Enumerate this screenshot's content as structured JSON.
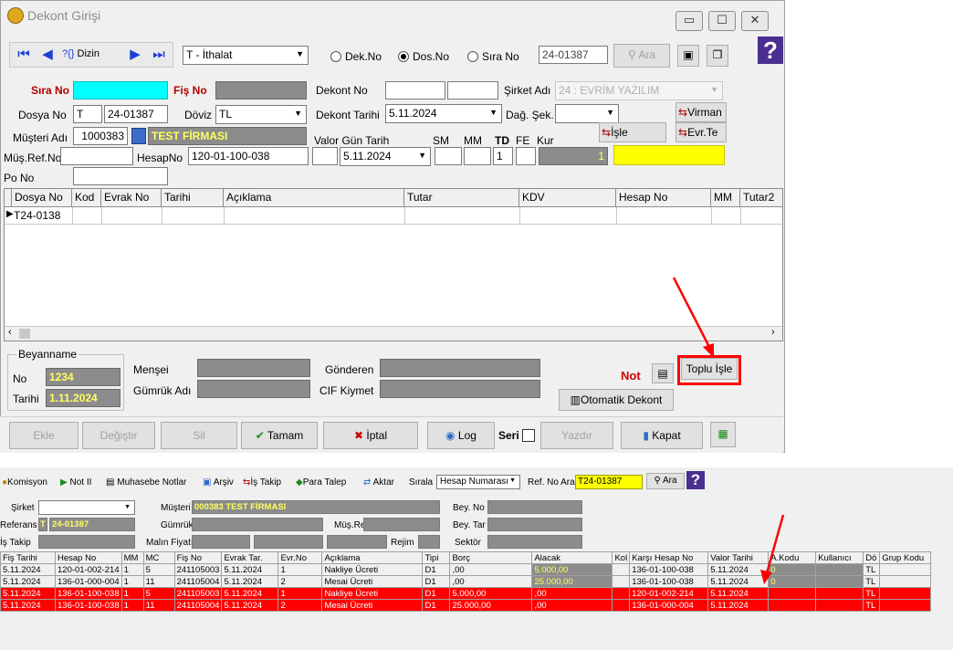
{
  "window": {
    "title": "Dekont Girişi"
  },
  "window_controls": {
    "minimize": "▭",
    "maximize": "☐",
    "close": "✕"
  },
  "nav": {
    "first": "⏮",
    "prev": "◀",
    "dizin": "Dizin",
    "dizin_prefix": "?{}",
    "next": "▶",
    "last": "⏭"
  },
  "type_select": {
    "value": "T - İthalat"
  },
  "search_modes": [
    {
      "label": "Dek.No",
      "selected": false
    },
    {
      "label": "Dos.No",
      "selected": true
    },
    {
      "label": "Sıra No",
      "selected": false
    }
  ],
  "search": {
    "value": "24-01387",
    "button": "Ara"
  },
  "help_icon": "?",
  "form": {
    "sira_no_label": "Sıra No",
    "sira_no": "",
    "fis_no_label": "Fiş No",
    "fis_no": "",
    "dekont_no_label": "Dekont No",
    "dekont_no": "",
    "dekont_no2": "",
    "sirket_label": "Şirket Adı",
    "sirket": "24 : EVRİM YAZILIM",
    "dosya_no_label": "Dosya No",
    "dosya_prefix": "T",
    "dosya_no": "24-01387",
    "doviz_label": "Döviz",
    "doviz": "TL",
    "dekont_tarihi_label": "Dekont Tarihi",
    "dekont_tarihi": "5.11.2024",
    "dag_sek_label": "Dağ. Şek.",
    "dag_sek": "",
    "virman_btn": "Virman",
    "musteri_label": "Müşteri Adı",
    "musteri_kod": "1000383",
    "musteri_ad": "TEST FİRMASI",
    "valor_label": "Valor Gün Tarih",
    "sm_label": "SM",
    "mm_label": "MM",
    "td_label": "TD",
    "fe_label": "FE",
    "kur_label": "Kur",
    "isle_btn": "İşle",
    "evr_btn": "Evr.Te",
    "mus_ref_label": "Müş.Ref.No",
    "mus_ref": "",
    "hesap_no_label": "HesapNo",
    "hesap_no": "120-01-100-038",
    "valor_tarih": "5.11.2024",
    "td_value": "1",
    "kur_value": "1",
    "po_no_label": "Po No",
    "po_no": ""
  },
  "grid": {
    "columns": [
      "Dosya No",
      "Kod",
      "Evrak No",
      "Tarihi",
      "Açıklama",
      "Tutar",
      "KDV",
      "Hesap No",
      "MM",
      "Tutar2"
    ],
    "rows": [
      {
        "dosya_no": "T24-0138"
      }
    ]
  },
  "beyanname": {
    "group_label": "Beyanname",
    "no_label": "No",
    "no": "1234",
    "tarihi_label": "Tarihi",
    "tarihi": "1.11.2024",
    "mensei_label": "Menşei",
    "gumruk_label": "Gümrük Adı",
    "gonderen_label": "Gönderen",
    "cif_label": "CIF Kiymet",
    "not_label": "Not",
    "toplu_isle_btn": "Toplu İşle",
    "otomatik_btn": "Otomatik Dekont"
  },
  "actions": {
    "ekle": "Ekle",
    "degistir": "Değiştir",
    "sil": "Sil",
    "tamam": "Tamam",
    "iptal": "İptal",
    "log": "Log",
    "seri": "Seri",
    "yazdir": "Yazdır",
    "kapat": "Kapat"
  },
  "bottom_toolbar": {
    "komisyon": "Komisyon",
    "not_ii": "Not II",
    "muhasebe": "Muhasebe Notlar",
    "arsiv": "Arşiv",
    "is_takip": "İş Takip",
    "para_talep": "Para Talep",
    "aktar": "Aktar",
    "sirala_label": "Sırala",
    "sirala_value": "Hesap Numarası",
    "ref_label": "Ref. No Ara",
    "ref_value": "T24-01387",
    "ara": "Ara"
  },
  "bottom_form": {
    "sirket_label": "Şirket",
    "musteri_label": "Müşteri",
    "musteri_value": "000383 TEST FİRMASI",
    "bey_no_label": "Bey. No",
    "referans_label": "Referans",
    "referans_prefix": "T",
    "referans_value": "24-01387",
    "gumruk_label": "Gümrük",
    "mus_ref_label": "Müş.Ref",
    "bey_tar_label": "Bey. Tar",
    "is_takip_label": "İş Takip",
    "malin_fiyati_label": "Malın Fiyatı",
    "rejim_label": "Rejim",
    "sektor_label": "Sektör"
  },
  "ledger": {
    "columns": [
      "Fiş Tarihi",
      "Hesap No",
      "MM",
      "MC",
      "Fiş No",
      "Evrak Tar.",
      "Evr.No",
      "Açıklama",
      "Tipi",
      "Borç",
      "Alacak",
      "Kol",
      "Karşı Hesap No",
      "Valor Tarihi",
      "A.Kodu",
      "Kullanıcı",
      "Dö",
      "Grup Kodu"
    ],
    "rows": [
      {
        "fis_tarihi": "5.11.2024",
        "hesap_no": "120-01-002-214",
        "mm": "1",
        "mc": "5",
        "fis_no": "241105003",
        "evrak_tar": "5.11.2024",
        "evr_no": "1",
        "aciklama": "Nakliye Ücreti",
        "tipi": "D1",
        "borc": ",00",
        "alacak": "5.000,00",
        "kol": "",
        "karsi": "136-01-100-038",
        "valor": "5.11.2024",
        "akodu": "0",
        "kullanici": "",
        "do": "TL",
        "grup": "",
        "red": false
      },
      {
        "fis_tarihi": "5.11.2024",
        "hesap_no": "136-01-000-004",
        "mm": "1",
        "mc": "11",
        "fis_no": "241105004",
        "evrak_tar": "5.11.2024",
        "evr_no": "2",
        "aciklama": "Mesai Ücreti",
        "tipi": "D1",
        "borc": ",00",
        "alacak": "25.000,00",
        "kol": "",
        "karsi": "136-01-100-038",
        "valor": "5.11.2024",
        "akodu": "0",
        "kullanici": "",
        "do": "TL",
        "grup": "",
        "red": false
      },
      {
        "fis_tarihi": "5.11.2024",
        "hesap_no": "136-01-100-038",
        "mm": "1",
        "mc": "5",
        "fis_no": "241105003",
        "evrak_tar": "5.11.2024",
        "evr_no": "1",
        "aciklama": "Nakliye Ücreti",
        "tipi": "D1",
        "borc": "5.000,00",
        "alacak": ",00",
        "kol": "",
        "karsi": "120-01-002-214",
        "valor": "5.11.2024",
        "akodu": "",
        "kullanici": "",
        "do": "TL",
        "grup": "",
        "red": true
      },
      {
        "fis_tarihi": "5.11.2024",
        "hesap_no": "136-01-100-038",
        "mm": "1",
        "mc": "11",
        "fis_no": "241105004",
        "evrak_tar": "5.11.2024",
        "evr_no": "2",
        "aciklama": "Mesai Ücreti",
        "tipi": "D1",
        "borc": "25.000,00",
        "alacak": ",00",
        "kol": "",
        "karsi": "136-01-000-004",
        "valor": "5.11.2024",
        "akodu": "",
        "kullanici": "",
        "do": "TL",
        "grup": "",
        "red": true
      }
    ]
  },
  "colors": {
    "accent_cyan": "#00ffff",
    "gray_field": "#8c8c8c",
    "yellow": "#ffff00",
    "highlight_red": "#ff0000"
  }
}
